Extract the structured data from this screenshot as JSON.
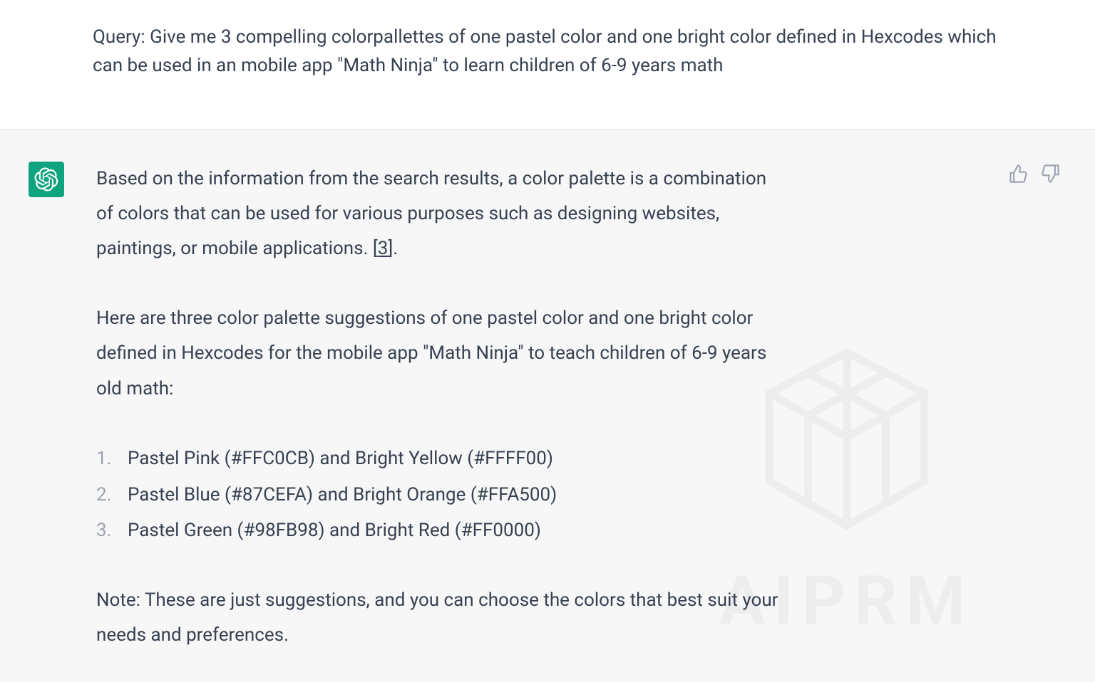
{
  "user": {
    "query_label": "Query: ",
    "query_text": "Give me 3 compelling colorpallettes of one pastel color and one bright color defined in Hexcodes which can be used in an mobile app \"Math Ninja\" to learn children of 6-9 years math"
  },
  "assistant": {
    "intro_part1": "Based on the information from the search results, a color palette is a combination of colors that can be used for various purposes such as designing websites, paintings, or mobile applications. [",
    "citation_number": "3",
    "intro_part2": "].",
    "suggestions_intro": "Here are three color palette suggestions of one pastel color and one bright color defined in Hexcodes for the mobile app \"Math Ninja\" to teach children of 6-9 years old math:",
    "palettes": [
      "Pastel Pink (#FFC0CB) and Bright Yellow (#FFFF00)",
      "Pastel Blue (#87CEFA) and Bright Orange (#FFA500)",
      "Pastel Green (#98FB98) and Bright Red (#FF0000)"
    ],
    "note": "Note: These are just suggestions, and you can choose the colors that best suit your needs and preferences."
  },
  "watermark": {
    "text": "AIPRM"
  }
}
